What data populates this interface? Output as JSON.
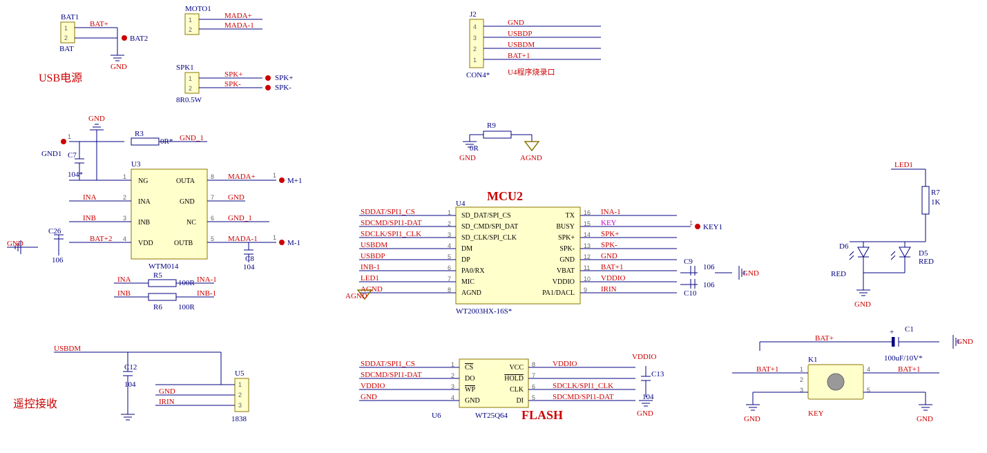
{
  "bat1": {
    "ref": "BAT1",
    "pins": [
      "1",
      "2"
    ],
    "foot": "BAT",
    "nets": [
      "BAT+",
      "BAT2"
    ],
    "gnd": "GND"
  },
  "moto1": {
    "ref": "MOTO1",
    "pins": [
      "1",
      "2"
    ],
    "nets": [
      "MADA+",
      "MADA-1"
    ]
  },
  "spk1": {
    "ref": "SPK1",
    "pins": [
      "1",
      "2"
    ],
    "foot": "8R0.5W",
    "nets": [
      "SPK+",
      "SPK-"
    ],
    "tp": [
      "SPK+",
      "SPK-"
    ]
  },
  "usb_title": "USB电源",
  "j2": {
    "ref": "J2",
    "pins": [
      "4",
      "3",
      "2",
      "1"
    ],
    "nets": [
      "GND",
      "USBDP",
      "USBDM",
      "BAT+1"
    ],
    "foot": "CON4*",
    "title": "U4程序烧录口"
  },
  "u3": {
    "ref": "U3",
    "part": "WTM014",
    "left": [
      [
        "NG",
        "1"
      ],
      [
        "INA",
        "2"
      ],
      [
        "INB",
        "3"
      ],
      [
        "VDD",
        "4"
      ]
    ],
    "right": [
      [
        "OUTA",
        "8"
      ],
      [
        "GND",
        "7"
      ],
      [
        "NC",
        "6"
      ],
      [
        "OUTB",
        "5"
      ]
    ],
    "left_nets": [
      "",
      "INA",
      "INB",
      "BAT+2"
    ],
    "right_nets": [
      "MADA+",
      "GND",
      "GND_1",
      "MADA-1"
    ],
    "right_tp": [
      "M+1",
      "",
      "",
      "M-1"
    ]
  },
  "gnd_net": "GND",
  "gnd1_net": "GND_1",
  "gnd1_tp": "GND1",
  "c7": {
    "ref": "C7",
    "val": "104*"
  },
  "c26": {
    "ref": "C26",
    "val": "106"
  },
  "c8": {
    "ref": "C8",
    "val": "104"
  },
  "r3": {
    "ref": "R3",
    "val": "0R*"
  },
  "r5": {
    "ref": "R5",
    "val": "100R",
    "in": "INA",
    "out": "INA-1"
  },
  "r6": {
    "ref": "R6",
    "val": "100R",
    "in": "INB",
    "out": "INB-1"
  },
  "r9": {
    "ref": "R9",
    "val": "0R",
    "left": "GND",
    "right": "AGND"
  },
  "r7": {
    "ref": "R7",
    "val": "1K"
  },
  "led1_net": "LED1",
  "d5": {
    "ref": "D5",
    "val": "RED"
  },
  "d6": {
    "ref": "D6",
    "val": "RED"
  },
  "c1": {
    "ref": "C1",
    "val": "100uF/10V*"
  },
  "k1": {
    "ref": "K1",
    "net": "KEY",
    "pins": [
      "1",
      "2",
      "3",
      "4",
      "5"
    ]
  },
  "bat_nets": {
    "batp": "BAT+",
    "batp1": "BAT+1"
  },
  "u4": {
    "ref": "U4",
    "part": "WT2003HX-16S*",
    "title": "MCU2",
    "left": [
      [
        "SD_DAT/SPI_CS",
        "1",
        "SDDAT/SPI1_CS"
      ],
      [
        "SD_CMD/SPI_DAT",
        "2",
        "SDCMD/SPI1-DAT"
      ],
      [
        "SD_CLK/SPI_CLK",
        "3",
        "SDCLK/SPI1_CLK"
      ],
      [
        "DM",
        "4",
        "USBDM"
      ],
      [
        "DP",
        "5",
        "USBDP"
      ],
      [
        "PA0/RX",
        "6",
        "INB-1"
      ],
      [
        "MIC",
        "7",
        "LED1"
      ],
      [
        "AGND",
        "8",
        "AGND"
      ]
    ],
    "right": [
      [
        "TX",
        "16",
        "INA-1"
      ],
      [
        "BUSY",
        "15",
        "KEY"
      ],
      [
        "SPK+",
        "14",
        "SPK+"
      ],
      [
        "SPK-",
        "13",
        "SPK-"
      ],
      [
        "GND",
        "12",
        "GND"
      ],
      [
        "VBAT",
        "11",
        "BAT+1"
      ],
      [
        "VDDIO",
        "10",
        "VDDIO"
      ],
      [
        "PA1/DACL",
        "9",
        "IRIN"
      ]
    ],
    "key_tp": "KEY1"
  },
  "c9": {
    "ref": "C9",
    "val": "106"
  },
  "c10": {
    "ref": "C10",
    "val": "106"
  },
  "u6": {
    "ref": "U6",
    "part": "WT25Q64",
    "title": "FLASH",
    "left": [
      [
        "CS",
        "1",
        "SDDAT/SPI1_CS"
      ],
      [
        "DO",
        "2",
        "SDCMD/SPI1-DAT"
      ],
      [
        "WP",
        "3",
        "VDDIO"
      ],
      [
        "GND",
        "4",
        "GND"
      ]
    ],
    "right": [
      [
        "VCC",
        "8",
        "VDDIO"
      ],
      [
        "HOLD",
        "7",
        ""
      ],
      [
        "CLK",
        "6",
        "SDCLK/SPI1_CLK"
      ],
      [
        "DI",
        "5",
        "SDCMD/SPI1-DAT"
      ]
    ]
  },
  "c13": {
    "ref": "C13",
    "val": "104"
  },
  "u5": {
    "ref": "U5",
    "part": "1838",
    "pins": [
      "1",
      "2",
      "3"
    ],
    "nets": [
      "",
      "GND",
      "IRIN"
    ]
  },
  "c12": {
    "ref": "C12",
    "val": "104"
  },
  "usbdm_net": "USBDM",
  "rx_title": "遥控接收"
}
